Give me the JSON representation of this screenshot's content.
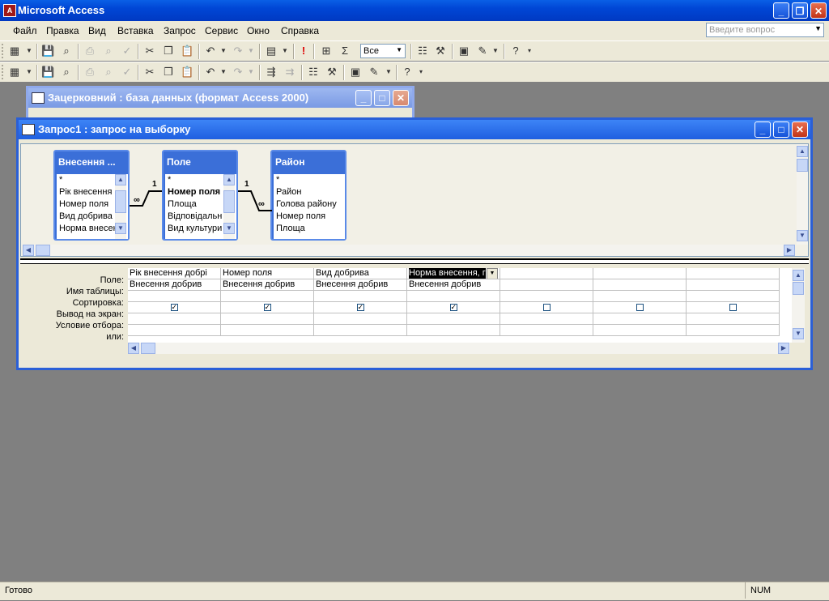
{
  "app": {
    "title": "Microsoft Access"
  },
  "menu": [
    "Файл",
    "Правка",
    "Вид",
    "Вставка",
    "Запрос",
    "Сервис",
    "Окно",
    "Справка"
  ],
  "help_placeholder": "Введите вопрос",
  "toolbar": {
    "combo_value": "Все"
  },
  "db_window": {
    "title": "Зацерковний : база данных (формат Access 2000)"
  },
  "query_window": {
    "title": "Запрос1 : запрос на выборку"
  },
  "tables": [
    {
      "title": "Внесення ...",
      "fields": [
        "*",
        "Рік внесення",
        "Номер поля",
        "Вид добрива",
        "Норма внесен"
      ]
    },
    {
      "title": "Поле",
      "fields": [
        "*",
        "Номер поля",
        "Площа",
        "Відповідальн",
        "Вид культури"
      ],
      "bold_field": "Номер поля"
    },
    {
      "title": "Район",
      "fields": [
        "*",
        "Район",
        "Голова району",
        "Номер поля",
        "Площа"
      ]
    }
  ],
  "relations": {
    "one": "1",
    "many": "∞"
  },
  "grid": {
    "row_labels": [
      "Поле:",
      "Имя таблицы:",
      "Сортировка:",
      "Вывод на экран:",
      "Условие отбора:",
      "или:"
    ],
    "columns": [
      {
        "field": "Рік внесення добрі",
        "table": "Внесення добрив",
        "show": true
      },
      {
        "field": "Номер поля",
        "table": "Внесення добрив",
        "show": true
      },
      {
        "field": "Вид добрива",
        "table": "Внесення добрив",
        "show": true
      },
      {
        "field": "Норма внесення, г",
        "table": "Внесення добрив",
        "show": true
      },
      {
        "field": "",
        "table": "",
        "show": false
      },
      {
        "field": "",
        "table": "",
        "show": false
      },
      {
        "field": "",
        "table": "",
        "show": false
      }
    ]
  },
  "status": {
    "left": "Готово",
    "num": "NUM"
  },
  "colors": {
    "titlebar": "#0046d5",
    "workspace": "#808080",
    "chrome": "#ece9d8"
  }
}
